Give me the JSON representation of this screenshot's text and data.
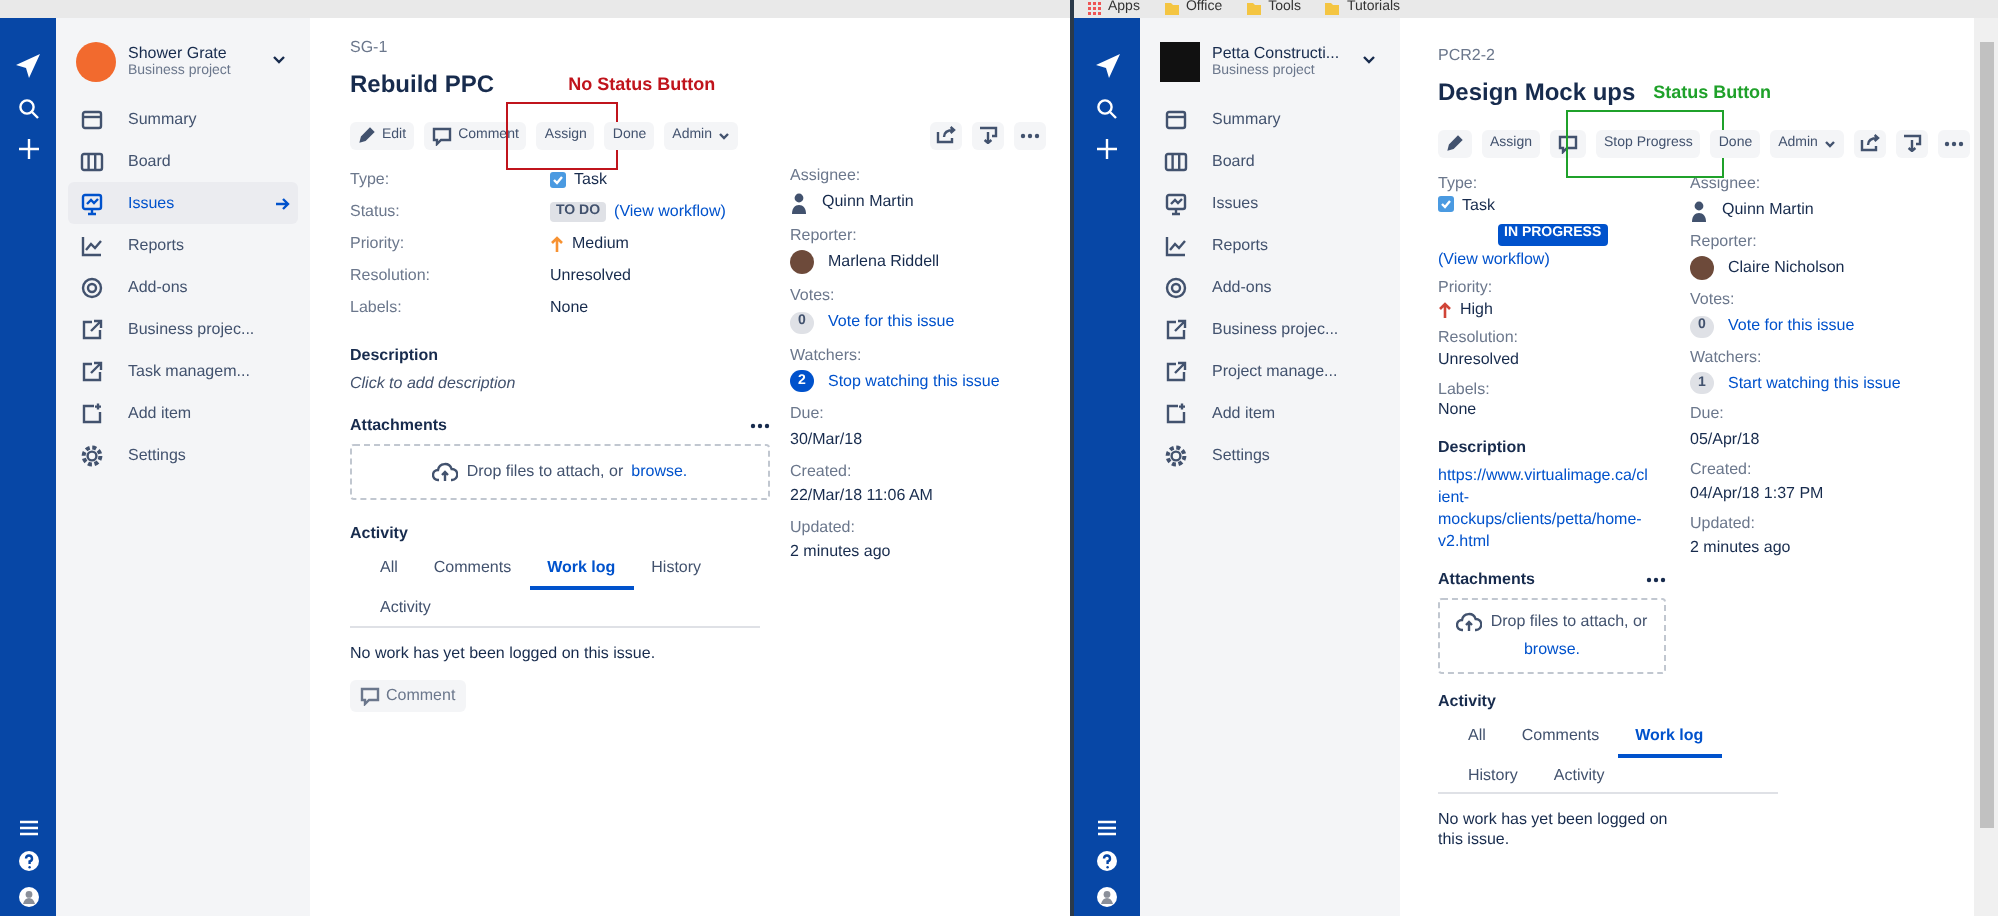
{
  "panes": [
    {
      "project": {
        "name": "Shower Grate",
        "type": "Business project"
      },
      "sidebar": [
        {
          "kind": "summary",
          "label": "Summary",
          "selected": false
        },
        {
          "kind": "board",
          "label": "Board",
          "selected": false
        },
        {
          "kind": "issues",
          "label": "Issues",
          "selected": true
        },
        {
          "kind": "reports",
          "label": "Reports",
          "selected": false
        },
        {
          "kind": "addons",
          "label": "Add-ons",
          "selected": false
        },
        {
          "kind": "link",
          "label": "Business projec...",
          "selected": false
        },
        {
          "kind": "link",
          "label": "Task managem...",
          "selected": false
        },
        {
          "kind": "add",
          "label": "Add item",
          "selected": false
        },
        {
          "kind": "settings",
          "label": "Settings",
          "selected": false
        }
      ],
      "issue_key": "SG-1",
      "title": "Rebuild PPC",
      "annotation": {
        "text": "No Status Button",
        "color": "#c0141c"
      },
      "toolbar": [
        {
          "kind": "edit",
          "label": "Edit",
          "highlighted": false
        },
        {
          "kind": "comment",
          "label": "Comment",
          "highlighted": false
        },
        {
          "kind": "action",
          "label": "Assign",
          "highlighted": true
        },
        {
          "kind": "action",
          "label": "Done",
          "highlighted": false
        },
        {
          "kind": "menu",
          "label": "Admin",
          "highlighted": false
        }
      ],
      "fields": [
        {
          "kind": "type",
          "label": "Type:",
          "value": "Task"
        },
        {
          "kind": "status",
          "label": "Status:",
          "value": "TO DO",
          "in_progress": false,
          "link": "(View workflow)"
        },
        {
          "kind": "priority",
          "label": "Priority:",
          "value": "Medium",
          "color": "#f79232"
        },
        {
          "kind": "text",
          "label": "Resolution:",
          "value": "Unresolved"
        },
        {
          "kind": "text",
          "label": "Labels:",
          "value": "None"
        }
      ],
      "description": {
        "heading": "Description",
        "kind": "placeholder",
        "text": "Click to add description"
      },
      "attachments": {
        "heading": "Attachments",
        "drop_text": "Drop files to attach, or",
        "browse": "browse."
      },
      "people": [
        {
          "kind": "user",
          "label": "Assignee:",
          "name": "Quinn Martin"
        },
        {
          "kind": "user_photo",
          "label": "Reporter:",
          "name": "Marlena Riddell"
        },
        {
          "kind": "counter",
          "label": "Votes:",
          "count": "0",
          "link": "Vote for this issue",
          "active": false
        },
        {
          "kind": "counter",
          "label": "Watchers:",
          "count": "2",
          "link": "Stop watching this issue",
          "active": true
        },
        {
          "kind": "date",
          "label": "Due:",
          "value": "30/Mar/18"
        },
        {
          "kind": "date",
          "label": "Created:",
          "value": "22/Mar/18 11:06 AM"
        },
        {
          "kind": "date",
          "label": "Updated:",
          "value": "2 minutes ago"
        }
      ],
      "activity": {
        "heading": "Activity",
        "tabs": [
          {
            "label": "All",
            "selected": false
          },
          {
            "label": "Comments",
            "selected": false
          },
          {
            "label": "Work log",
            "selected": true
          },
          {
            "label": "History",
            "selected": false
          },
          {
            "label": "Activity",
            "selected": false
          }
        ],
        "message": "No work has yet been logged on this issue.",
        "comment_button": "Comment"
      }
    },
    {
      "bookmarks": [
        "Apps",
        "Office",
        "Tools",
        "Tutorials"
      ],
      "project": {
        "name": "Petta Constructi...",
        "type": "Business project"
      },
      "sidebar": [
        {
          "kind": "summary",
          "label": "Summary",
          "selected": false
        },
        {
          "kind": "board",
          "label": "Board",
          "selected": false
        },
        {
          "kind": "issues",
          "label": "Issues",
          "selected": false
        },
        {
          "kind": "reports",
          "label": "Reports",
          "selected": false
        },
        {
          "kind": "addons",
          "label": "Add-ons",
          "selected": false
        },
        {
          "kind": "link",
          "label": "Business projec...",
          "selected": false
        },
        {
          "kind": "link",
          "label": "Project manage...",
          "selected": false
        },
        {
          "kind": "add",
          "label": "Add item",
          "selected": false
        },
        {
          "kind": "settings",
          "label": "Settings",
          "selected": false
        }
      ],
      "issue_key": "PCR2-2",
      "title": "Design Mock ups",
      "annotation": {
        "text": "Status Button",
        "color": "#1fa12a"
      },
      "toolbar": [
        {
          "kind": "edit",
          "highlighted": false
        },
        {
          "kind": "action",
          "label": "Assign",
          "highlighted": false
        },
        {
          "kind": "comment",
          "highlighted": false
        },
        {
          "kind": "action",
          "label": "Stop Progress",
          "highlighted": true
        },
        {
          "kind": "action",
          "label": "Done",
          "highlighted": false
        },
        {
          "kind": "menu",
          "label": "Admin",
          "highlighted": false
        }
      ],
      "fields": [
        {
          "kind": "type",
          "label": "Type:",
          "value": "Task"
        },
        {
          "kind": "status",
          "value": "IN PROGRESS",
          "in_progress": true,
          "link": "(View workflow)"
        },
        {
          "kind": "priority",
          "label": "Priority:",
          "value": "High",
          "color": "#d04437"
        },
        {
          "kind": "text",
          "label": "Resolution:",
          "value": "Unresolved"
        },
        {
          "kind": "text",
          "label": "Labels:",
          "value": "None"
        }
      ],
      "description": {
        "heading": "Description",
        "kind": "link",
        "text": "https://www.virtualimage.ca/client-mockups/clients/petta/home-v2.html"
      },
      "attachments": {
        "heading": "Attachments",
        "drop_text": "Drop files to attach, or",
        "browse": "browse."
      },
      "people": [
        {
          "kind": "user",
          "label": "Assignee:",
          "name": "Quinn Martin"
        },
        {
          "kind": "user_photo",
          "label": "Reporter:",
          "name": "Claire Nicholson"
        },
        {
          "kind": "counter",
          "label": "Votes:",
          "count": "0",
          "link": "Vote for this issue",
          "active": false
        },
        {
          "kind": "counter",
          "label": "Watchers:",
          "count": "1",
          "link": "Start watching this issue",
          "active": false
        },
        {
          "kind": "date",
          "label": "Due:",
          "value": "05/Apr/18"
        },
        {
          "kind": "date",
          "label": "Created:",
          "value": "04/Apr/18 1:37 PM"
        },
        {
          "kind": "date",
          "label": "Updated:",
          "value": "2 minutes ago"
        }
      ],
      "activity": {
        "heading": "Activity",
        "tabs": [
          {
            "label": "All",
            "selected": false
          },
          {
            "label": "Comments",
            "selected": false
          },
          {
            "label": "Work log",
            "selected": true
          },
          {
            "label": "History",
            "selected": false
          },
          {
            "label": "Activity",
            "selected": false
          }
        ],
        "message": "No work has yet been logged on this issue."
      }
    }
  ]
}
